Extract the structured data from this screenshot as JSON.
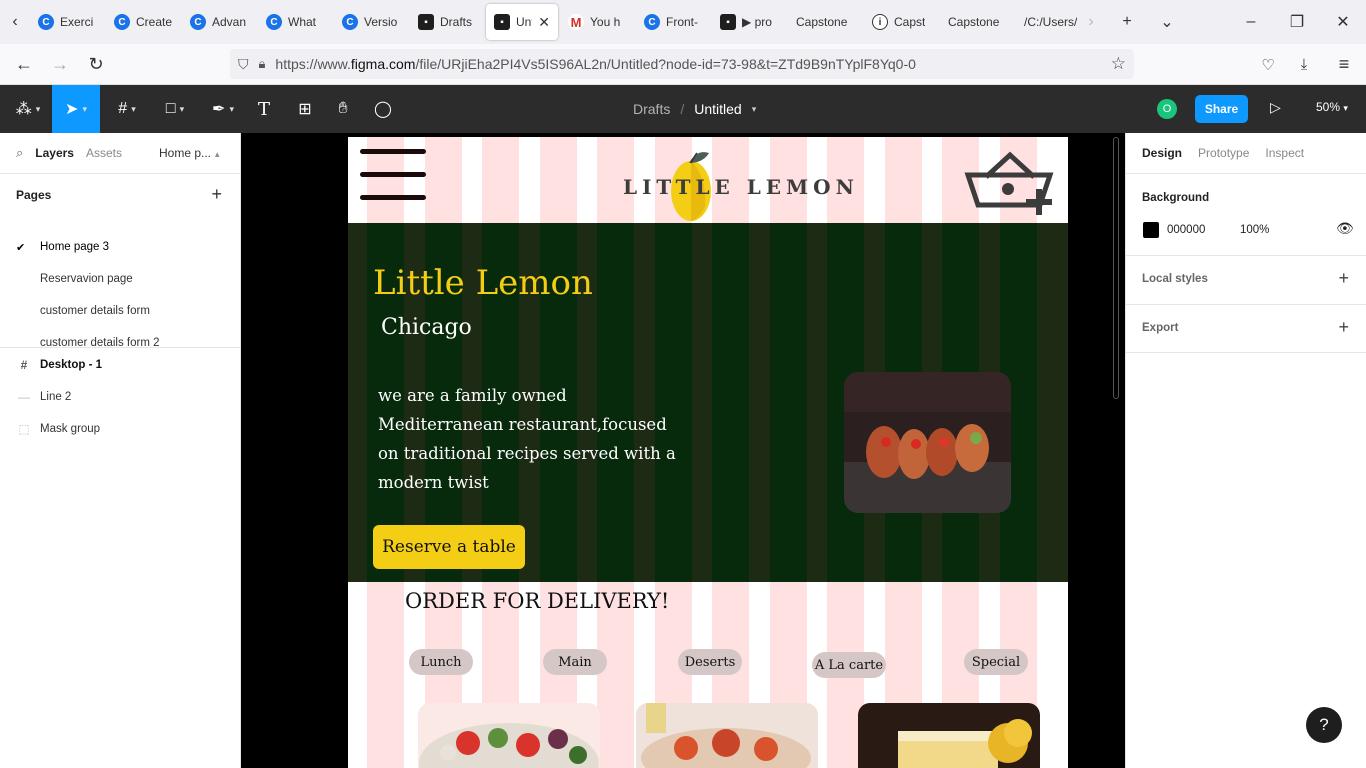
{
  "browser": {
    "tabs": [
      {
        "label": "Exerci",
        "icon": "coursera-icon"
      },
      {
        "label": "Create",
        "icon": "coursera-icon"
      },
      {
        "label": "Advan",
        "icon": "coursera-icon"
      },
      {
        "label": "What",
        "icon": "coursera-icon"
      },
      {
        "label": "Versio",
        "icon": "coursera-icon"
      },
      {
        "label": "Drafts",
        "icon": "figma-icon"
      },
      {
        "label": "Unt",
        "icon": "figma-icon",
        "active": true
      },
      {
        "label": "You h",
        "icon": "gmail-icon"
      },
      {
        "label": "Front-",
        "icon": "coursera-icon"
      },
      {
        "label": "▶ pro",
        "icon": "figma-icon"
      },
      {
        "label": "Capstone",
        "icon": "none"
      },
      {
        "label": "Capst",
        "icon": "info-icon"
      },
      {
        "label": "Capstone",
        "icon": "none"
      },
      {
        "label": "/C:/Users/",
        "icon": "none"
      }
    ],
    "url_prefix": "https://www.",
    "url_domain": "figma.com",
    "url_rest": "/file/URjiEha2PI4Vs5IS96AL2n/Untitled?node-id=73-98&t=ZTd9B9nTYplF8Yq0-0"
  },
  "figma": {
    "breadcrumb_drafts": "Drafts",
    "breadcrumb_sep": "/",
    "file_name": "Untitled",
    "avatar_initial": "O",
    "share_label": "Share",
    "zoom": "50%"
  },
  "left_panel": {
    "tab_layers": "Layers",
    "tab_assets": "Assets",
    "page_selector": "Home p...",
    "pages_header": "Pages",
    "pages": [
      {
        "label": "Home page 3",
        "current": true
      },
      {
        "label": "Reservavion page"
      },
      {
        "label": "customer details form"
      },
      {
        "label": "customer details form 2"
      }
    ],
    "layers": [
      {
        "label": "Desktop - 1",
        "icon": "frame-icon"
      },
      {
        "label": "Line 2",
        "icon": "line-icon"
      },
      {
        "label": "Mask group",
        "icon": "mask-icon"
      }
    ]
  },
  "right_panel": {
    "tab_design": "Design",
    "tab_prototype": "Prototype",
    "tab_inspect": "Inspect",
    "background_label": "Background",
    "bg_hex": "000000",
    "bg_opacity": "100%",
    "local_styles_label": "Local styles",
    "export_label": "Export"
  },
  "design": {
    "logo_text": "LITTLE LEMON",
    "hero_title": "Little Lemon",
    "hero_city": "Chicago",
    "hero_desc": "we are a family owned Mediterranean restaurant,focused on traditional recipes served with a modern twist",
    "reserve_btn": "Reserve a table",
    "order_title": "ORDER FOR DELIVERY!",
    "categories": [
      "Lunch",
      "Main",
      "Deserts",
      "A La carte",
      "Special"
    ],
    "colors": {
      "yellow": "#f4ce14",
      "hero_green": "#1d2a14",
      "grid_pink": "#ffe1e1"
    }
  }
}
